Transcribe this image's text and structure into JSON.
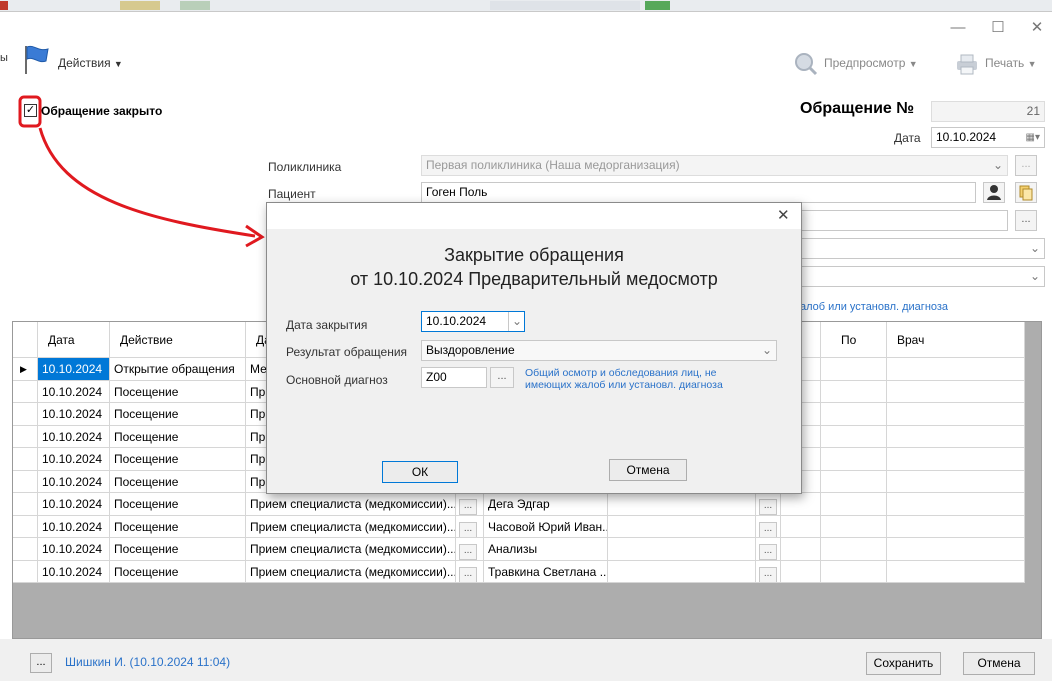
{
  "toolbar": {
    "actions_label": "Действия",
    "preview_label": "Предпросмотр",
    "print_label": "Печать"
  },
  "form": {
    "closed_checkbox_label": "Обращение закрыто",
    "case_number_label": "Обращение №",
    "case_number_value": "21",
    "date_label": "Дата",
    "date_value": "10.10.2024",
    "clinic_label": "Поликлиника",
    "clinic_value": "Первая поликлиника (Наша медорганизация)",
    "patient_label": "Пациент",
    "patient_value": "Гоген Поль",
    "diagnosis_link_fragment": "алоб или установл. диагноза"
  },
  "grid": {
    "columns": [
      "Дата",
      "Действие",
      "Да",
      "По",
      "Врач"
    ],
    "rows": [
      {
        "date": "10.10.2024",
        "action": "Открытие обращения",
        "type": "Ме",
        "doctor": "",
        "selected": true
      },
      {
        "date": "10.10.2024",
        "action": "Посещение",
        "type": "Пр",
        "doctor": ""
      },
      {
        "date": "10.10.2024",
        "action": "Посещение",
        "type": "Пр",
        "doctor": ""
      },
      {
        "date": "10.10.2024",
        "action": "Посещение",
        "type": "Пр",
        "doctor": ""
      },
      {
        "date": "10.10.2024",
        "action": "Посещение",
        "type": "Пр",
        "doctor": ""
      },
      {
        "date": "10.10.2024",
        "action": "Посещение",
        "type": "Пр",
        "doctor": ""
      },
      {
        "date": "10.10.2024",
        "action": "Посещение",
        "type": "Прием специалиста (медкомиссии)...",
        "doctor": "Дега Эдгар"
      },
      {
        "date": "10.10.2024",
        "action": "Посещение",
        "type": "Прием специалиста (медкомиссии)...",
        "doctor": "Часовой Юрий Иван..."
      },
      {
        "date": "10.10.2024",
        "action": "Посещение",
        "type": "Прием специалиста (медкомиссии)...",
        "doctor": "Анализы"
      },
      {
        "date": "10.10.2024",
        "action": "Посещение",
        "type": "Прием специалиста (медкомиссии)...",
        "doctor": "Травкина Светлана ..."
      }
    ]
  },
  "dialog": {
    "title_line1": "Закрытие обращения",
    "title_line2": "от 10.10.2024 Предварительный медосмотр",
    "close_date_label": "Дата закрытия",
    "close_date_value": "10.10.2024",
    "result_label": "Результат обращения",
    "result_value": "Выздоровление",
    "diagnosis_label": "Основной диагноз",
    "diagnosis_code": "Z00",
    "diagnosis_text_line1": "Общий осмотр и обследования лиц, не",
    "diagnosis_text_line2": "имеющих жалоб или установл. диагноза",
    "ok_label": "ОК",
    "cancel_label": "Отмена",
    "dots": "..."
  },
  "footer": {
    "author_text": "Шишкин И. (10.10.2024 11:04)",
    "save_label": "Сохранить",
    "cancel_label": "Отмена",
    "dots": "..."
  },
  "colors": {
    "annotation_red": "#e0191f",
    "link_blue": "#2a72c9",
    "selected_row": "#0078d7"
  }
}
